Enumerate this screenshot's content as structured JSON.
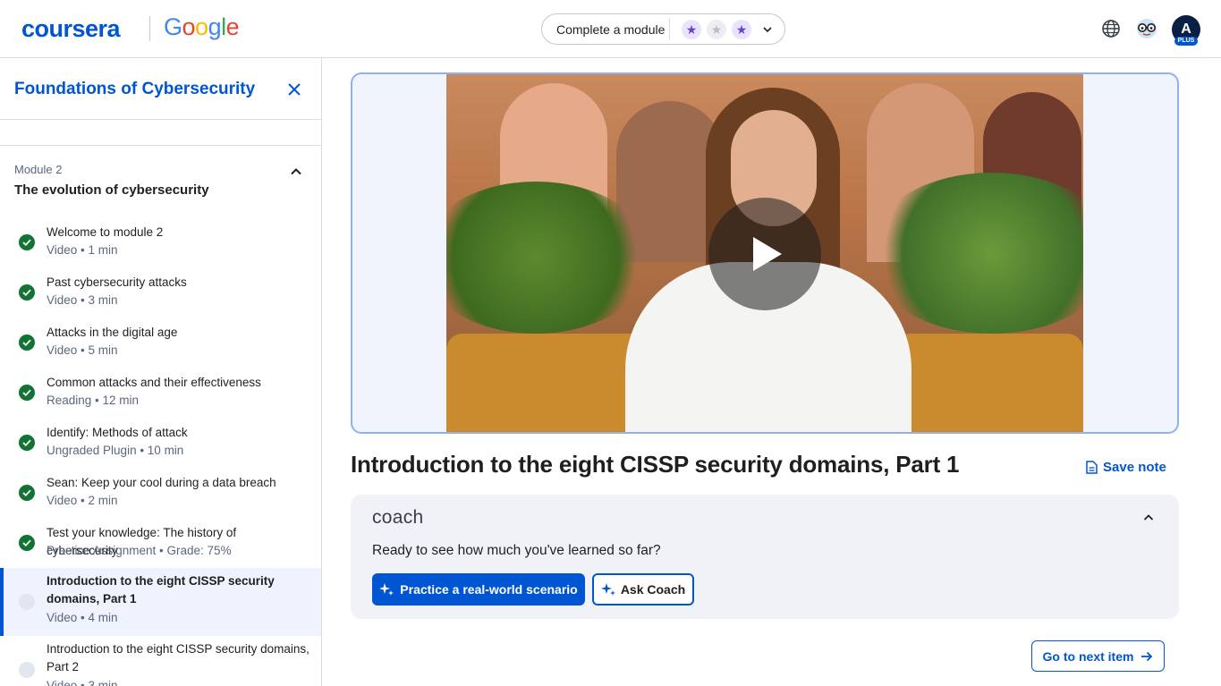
{
  "header": {
    "brand": "coursera",
    "partner": [
      "G",
      "o",
      "o",
      "g",
      "l",
      "e"
    ],
    "partner_colors": [
      "#4285F4",
      "#EA4335",
      "#FBBC05",
      "#4285F4",
      "#34A853",
      "#EA4335"
    ],
    "goal_label": "Complete a module",
    "goal_stars": [
      true,
      false,
      true
    ],
    "avatar_initial": "A",
    "avatar_badge": "PLUS",
    "icons": [
      "globe-icon",
      "coach-glasses-icon"
    ]
  },
  "sidebar": {
    "course_title": "Foundations of Cybersecurity",
    "module_label": "Module 2",
    "module_name": "The evolution of cybersecurity",
    "items": [
      {
        "title": "Welcome to module 2",
        "meta": "Video • 1 min",
        "done": true
      },
      {
        "title": "Past cybersecurity attacks",
        "meta": "Video • 3 min",
        "done": true
      },
      {
        "title": "Attacks in the digital age",
        "meta": "Video • 5 min",
        "done": true
      },
      {
        "title": "Common attacks and their effectiveness",
        "meta": "Reading • 12 min",
        "done": true
      },
      {
        "title": "Identify: Methods of attack",
        "meta": "Ungraded Plugin • 10 min",
        "done": true
      },
      {
        "title": "Sean: Keep your cool during a data breach",
        "meta": "Video • 2 min",
        "done": true
      },
      {
        "title": "Test your knowledge: The history of cybersecurity",
        "meta": "Practice Assignment • Grade: 75%",
        "done": true
      },
      {
        "title": "Introduction to the eight CISSP security domains, Part 1",
        "meta": "Video • 4 min",
        "done": false,
        "active": true
      },
      {
        "title": "Introduction to the eight CISSP security domains, Part 2",
        "meta": "Video • 3 min",
        "done": false
      }
    ]
  },
  "main": {
    "title": "Introduction to the eight CISSP security domains, Part 1",
    "save_note": "Save note",
    "coach": {
      "logo": "coach",
      "prompt": "Ready to see how much you've learned so far?",
      "practice_button": "Practice a real-world scenario",
      "ask_button": "Ask Coach"
    },
    "next_button": "Go to next item"
  },
  "colors": {
    "brand_blue": "#0056d2",
    "complete_green": "#137333",
    "star_purple": "#6b3fd6"
  }
}
